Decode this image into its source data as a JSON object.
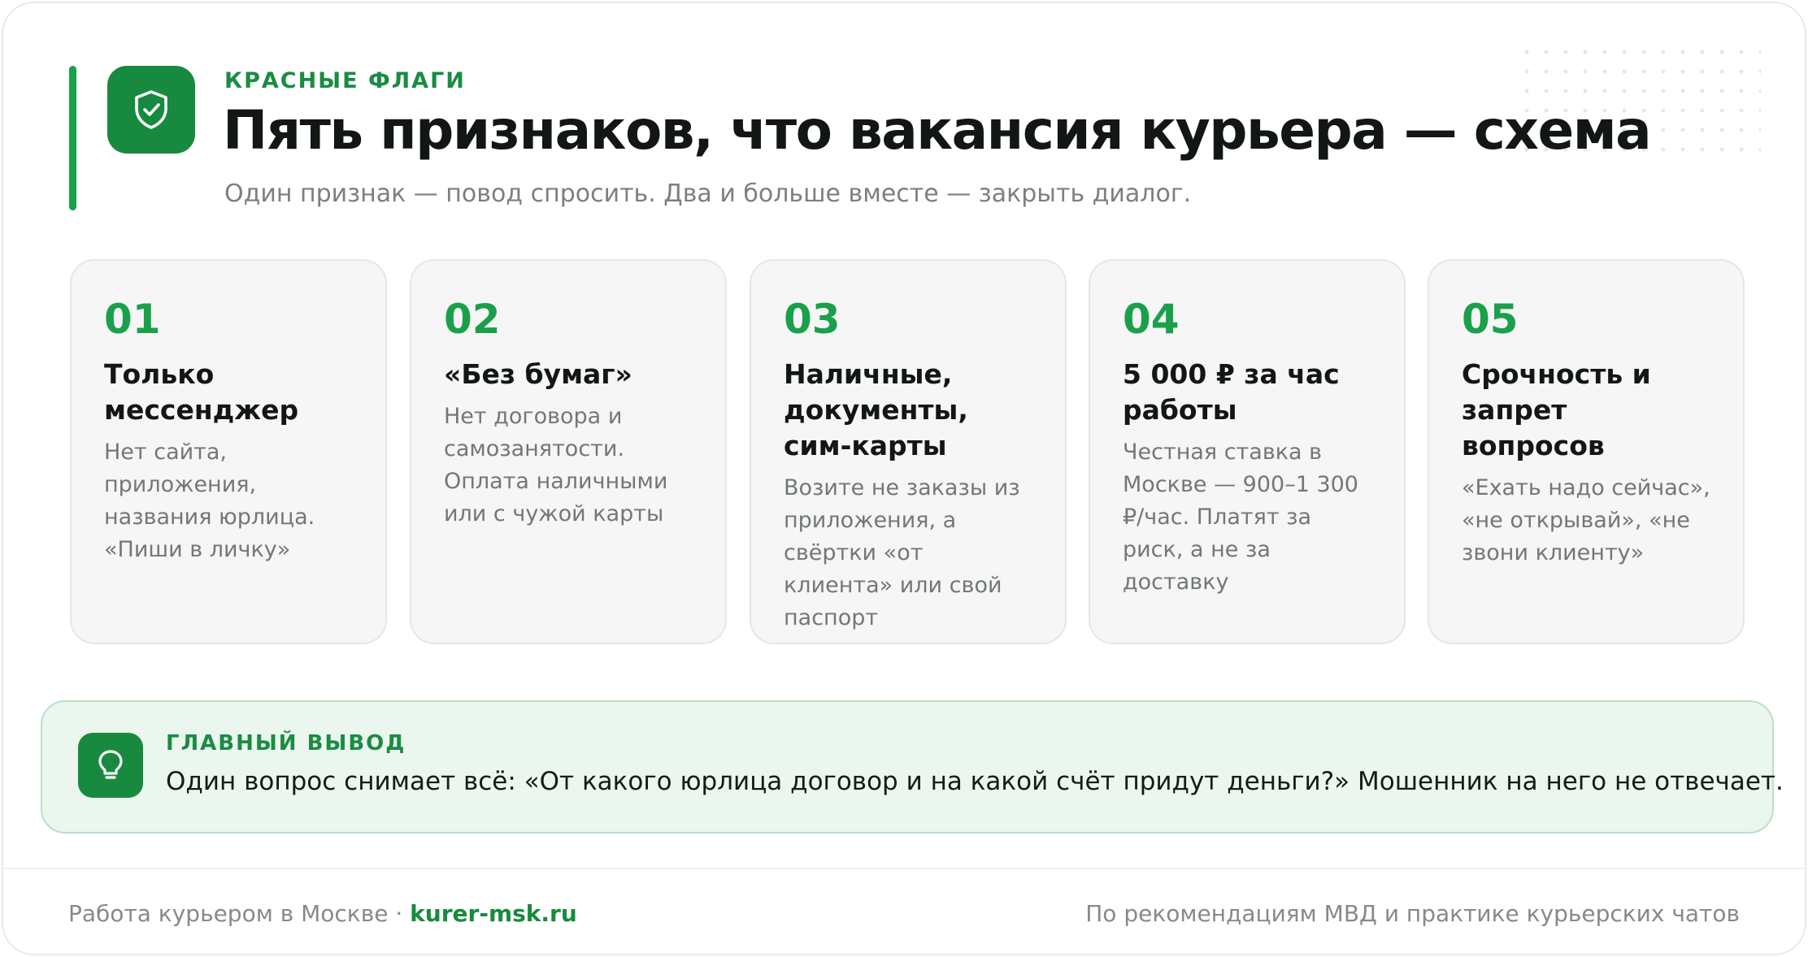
{
  "header": {
    "eyebrow": "КРАСНЫЕ ФЛАГИ",
    "title": "Пять признаков, что вакансия курьера — схема",
    "subtitle": "Один признак — повод спросить. Два и больше вместе — закрыть диалог.",
    "icon": "shield-check-icon"
  },
  "flags": [
    {
      "num": "01",
      "title": "Только мессенджер",
      "text": "Нет сайта, приложения, названия юрлица. «Пиши в личку»"
    },
    {
      "num": "02",
      "title": "«Без бумаг»",
      "text": "Нет договора и самозанятости. Оплата наличными или с чужой карты"
    },
    {
      "num": "03",
      "title": "Наличные, документы, сим-карты",
      "text": "Возите не заказы из приложения, а свёртки «от клиента» или свой паспорт"
    },
    {
      "num": "04",
      "title": "5 000 ₽ за час работы",
      "text": "Честная ставка в Москве — 900–1 300 ₽/час. Платят за риск, а не за доставку"
    },
    {
      "num": "05",
      "title": "Срочность и запрет вопросов",
      "text": "«Ехать надо сейчас», «не открывай», «не звони клиенту»"
    }
  ],
  "takeaway": {
    "label": "ГЛАВНЫЙ ВЫВОД",
    "text": "Один вопрос снимает всё: «От какого юрлица договор и на какой счёт придут деньги?» Мошенник на него не отвечает.",
    "icon": "lightbulb-icon"
  },
  "footer": {
    "left_text": "Работа курьером в Москве · ",
    "link": "kurer-msk.ru",
    "right_text": "По рекомендациям МВД и практике курьерских чатов"
  },
  "colors": {
    "accent": "#1aa04a",
    "accent_dark": "#178a3f",
    "takeaway_bg": "#eaf6ee"
  }
}
